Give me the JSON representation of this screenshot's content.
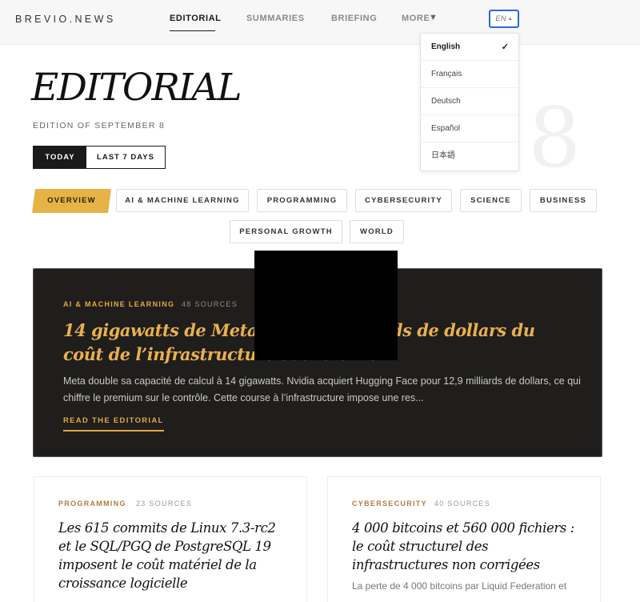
{
  "header": {
    "logo": "BREVIO.NEWS",
    "nav": [
      {
        "label": "EDITORIAL",
        "active": true
      },
      {
        "label": "SUMMARIES",
        "active": false
      },
      {
        "label": "BRIEFING",
        "active": false
      },
      {
        "label": "MORE",
        "active": false
      }
    ],
    "more_arrow": "▼",
    "lang_button": "EN",
    "lang_caret": "▲"
  },
  "language_menu": {
    "options": [
      "English",
      "Français",
      "Deutsch",
      "Español",
      "日本語"
    ],
    "selected": "English",
    "check": "✓"
  },
  "hero": {
    "title": "EDITORIAL",
    "edition": "EDITION OF SEPTEMBER 8",
    "big_number": "8",
    "toggle": {
      "today": "TODAY",
      "last7": "LAST 7 DAYS"
    }
  },
  "categories": [
    "OVERVIEW",
    "AI & MACHINE LEARNING",
    "PROGRAMMING",
    "CYBERSECURITY",
    "SCIENCE",
    "BUSINESS",
    "PERSONAL GROWTH",
    "WORLD"
  ],
  "featured": {
    "category": "AI & MACHINE LEARNING",
    "sources": "48 SOURCES",
    "title": "14 gigawatts de Meta et 12,9 milliards de dollars du coût de l’infrastructure souveraine",
    "excerpt": "Meta double sa capacité de calcul à 14 gigawatts. Nvidia acquiert Hugging Face pour 12,9 milliards de dollars, ce qui chiffre le premium sur le contrôle. Cette course à l’infrastructure impose une res...",
    "link": "READ THE EDITORIAL"
  },
  "cards": [
    {
      "category": "PROGRAMMING",
      "sources": "23 SOURCES",
      "title": "Les 615 commits de Linux 7.3-rc2 et le SQL/PGQ de PostgreSQL 19 imposent le coût matériel de la croissance logicielle",
      "excerpt": ""
    },
    {
      "category": "CYBERSECURITY",
      "sources": "40 SOURCES",
      "title": "4 000 bitcoins et 560 000 fichiers : le coût structurel des infrastructures non corrigées",
      "excerpt": "La perte de 4 000 bitcoins par Liquid Federation et"
    }
  ],
  "colors": {
    "accent": "#e7b347",
    "feature_bg": "#1f1e1c",
    "card_category": "#b6793c",
    "lang_border": "#2d68d9"
  }
}
